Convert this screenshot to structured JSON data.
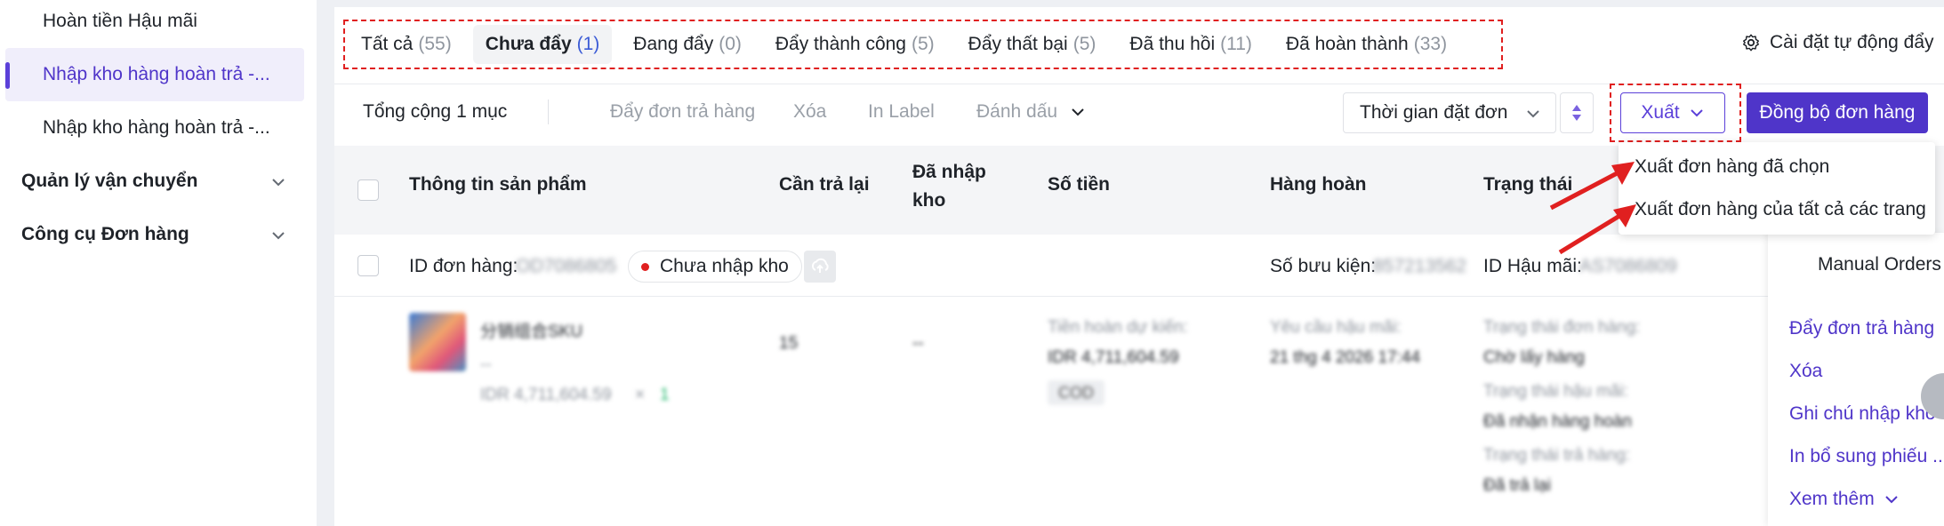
{
  "sidebar": {
    "items": [
      {
        "label": "Hoàn tiền Hậu mãi"
      },
      {
        "label": "Nhập kho hàng hoàn trả -..."
      },
      {
        "label": "Nhập kho hàng hoàn trả -..."
      }
    ],
    "groups": [
      {
        "label": "Quản lý vận chuyển"
      },
      {
        "label": "Công cụ Đơn hàng"
      }
    ]
  },
  "tabs": [
    {
      "label": "Tất cả",
      "count": "(55)"
    },
    {
      "label": "Chưa đẩy",
      "count": "(1)"
    },
    {
      "label": "Đang đẩy",
      "count": "(0)"
    },
    {
      "label": "Đẩy thành công",
      "count": "(5)"
    },
    {
      "label": "Đẩy thất bại",
      "count": "(5)"
    },
    {
      "label": "Đã thu hồi",
      "count": "(11)"
    },
    {
      "label": "Đã hoàn thành",
      "count": "(33)"
    }
  ],
  "auto_settings_label": "Cài đặt tự động đẩy",
  "toolbar": {
    "total": "Tổng cộng 1 mục",
    "push_return": "Đẩy đơn trả hàng",
    "delete": "Xóa",
    "print_label": "In Label",
    "mark": "Đánh dấu",
    "time_select": "Thời gian đặt đơn",
    "export": "Xuất",
    "sync": "Đồng bộ đơn hàng"
  },
  "export_menu": [
    "Xuất đơn hàng đã chọn",
    "Xuất đơn hàng của tất cả các trang"
  ],
  "table": {
    "headers": {
      "product": "Thông tin sản phẩm",
      "to_return": "Cần trả lại",
      "received_l1": "Đã nhập",
      "received_l2": "kho",
      "amount": "Số tiền",
      "return_goods": "Hàng hoàn",
      "status": "Trạng thái"
    },
    "order": {
      "id_label": "ID đơn hàng:",
      "id_value": "OD7086805",
      "status": "Chưa nhập kho",
      "parcel_label": "Số bưu kiện:",
      "parcel_value": "857213562",
      "aftersale_label": "ID Hậu mãi:",
      "aftersale_value": "AS7086809"
    },
    "row": {
      "sku_name": "分销组合SKU",
      "sku_sub": "--",
      "price_qty": "IDR 4,711,604.59",
      "mult": "×",
      "qty": "1",
      "to_return": "15",
      "received": "--",
      "amount_label": "Tiền hoàn dự kiến:",
      "amount_value": "IDR 4,711,604.59",
      "payment": "COD",
      "request_label": "Yêu cầu hậu mãi:",
      "request_value": "21 thg 4 2026 17:44",
      "order_status_label": "Trạng thái đơn hàng:",
      "order_status_value": "Chờ lấy hàng",
      "aftersale_status_label": "Trạng thái hậu mãi:",
      "aftersale_status_value": "Đã nhận hàng hoàn",
      "return_status_label": "Trạng thái trả hàng:",
      "return_status_value": "Đã trả lại"
    }
  },
  "side_panel": {
    "manual": "Manual Orders",
    "links": [
      "Đẩy đơn trả hàng",
      "Xóa",
      "Ghi chú nhập kho",
      "In bổ sung phiếu ...",
      "Xem thêm"
    ]
  },
  "colors": {
    "accent": "#4f35c9",
    "annotation_red": "#e02020"
  }
}
